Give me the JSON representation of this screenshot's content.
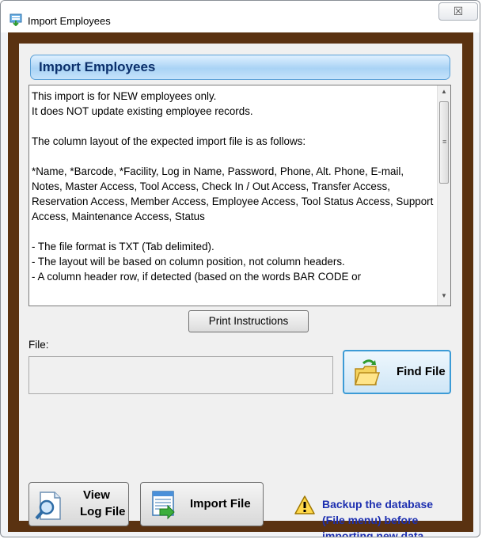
{
  "window": {
    "title": "Import Employees",
    "close_label": "☒"
  },
  "header": {
    "title": "Import Employees"
  },
  "instructions": {
    "text": "This import is for NEW employees only.\nIt does NOT update existing employee records.\n\nThe column layout of the expected import file is as follows:\n\n*Name, *Barcode, *Facility, Log in Name, Password, Phone, Alt. Phone, E-mail, Notes, Master Access, Tool Access, Check In / Out Access, Transfer Access, Reservation Access, Member Access, Employee Access, Tool Status Access, Support Access, Maintenance Access, Status\n\n- The file format is TXT (Tab delimited).\n- The layout will be based on column position, not column headers.\n- A column header row, if detected (based on the words BAR CODE or"
  },
  "buttons": {
    "print_instructions": "Print Instructions",
    "find_file": "Find File",
    "view_log_line1": "View",
    "view_log_line2": "Log File",
    "import_file": "Import File"
  },
  "file": {
    "label": "File:",
    "value": ""
  },
  "warning": {
    "line1": "Backup the database",
    "line2": "(File menu) before",
    "line3": "importing new data"
  },
  "colors": {
    "frame": "#5a3211",
    "header_text": "#0b2f6b",
    "warning_text": "#1d2fb0",
    "accent_border": "#3c9bd6"
  }
}
